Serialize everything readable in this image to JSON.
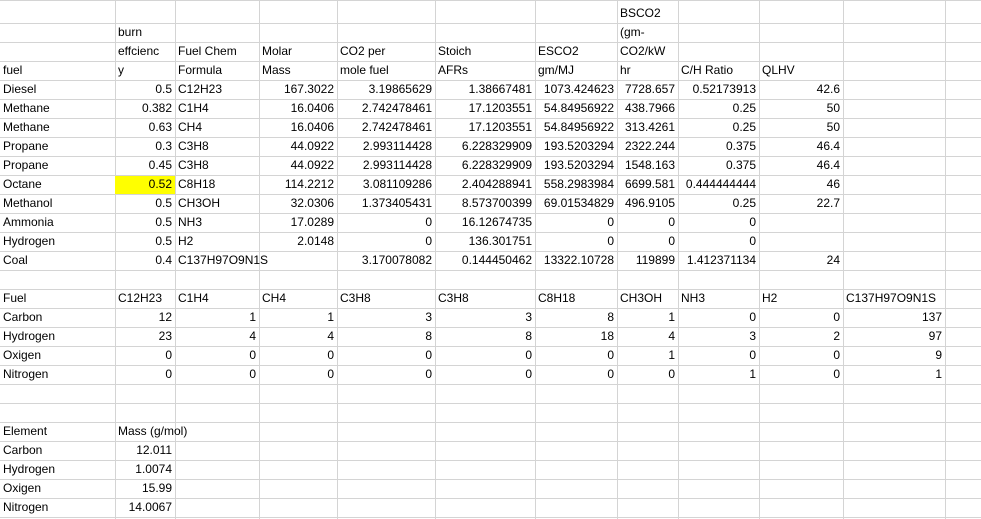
{
  "sheet": {
    "header": {
      "fuel": "fuel",
      "burn_line1": "burn",
      "burn_line2": "effcienc",
      "burn_line3": "y",
      "chem_line1": "Fuel Chem",
      "chem_line2": "Formula",
      "molar_line1": "Molar",
      "molar_line2": "Mass",
      "co2_line1": "CO2 per",
      "co2_line2": "mole fuel",
      "stoich_line1": "Stoich",
      "stoich_line2": "AFRs",
      "esco2_line1": "ESCO2",
      "esco2_line2": "gm/MJ",
      "bsco2_line1": "BSCO2",
      "bsco2_line2": "(gm-",
      "bsco2_line3": "CO2/kW",
      "bsco2_line4": "hr",
      "ch_ratio": "C/H Ratio",
      "qlhv": "QLHV"
    },
    "fuels": [
      {
        "fuel": "Diesel",
        "burn": "0.5",
        "formula": "C12H23",
        "molar": "167.3022",
        "co2": "3.19865629",
        "stoich": "1.38667481",
        "esco2": "1073.424623",
        "bsco2": "7728.657",
        "ch": "0.52173913",
        "qlhv": "42.6"
      },
      {
        "fuel": "Methane",
        "burn": "0.382",
        "formula": "C1H4",
        "molar": "16.0406",
        "co2": "2.742478461",
        "stoich": "17.1203551",
        "esco2": "54.84956922",
        "bsco2": "438.7966",
        "ch": "0.25",
        "qlhv": "50"
      },
      {
        "fuel": "Methane",
        "burn": "0.63",
        "formula": "CH4",
        "molar": "16.0406",
        "co2": "2.742478461",
        "stoich": "17.1203551",
        "esco2": "54.84956922",
        "bsco2": "313.4261",
        "ch": "0.25",
        "qlhv": "50"
      },
      {
        "fuel": "Propane",
        "burn": "0.3",
        "formula": "C3H8",
        "molar": "44.0922",
        "co2": "2.993114428",
        "stoich": "6.228329909",
        "esco2": "193.5203294",
        "bsco2": "2322.244",
        "ch": "0.375",
        "qlhv": "46.4"
      },
      {
        "fuel": "Propane",
        "burn": "0.45",
        "formula": "C3H8",
        "molar": "44.0922",
        "co2": "2.993114428",
        "stoich": "6.228329909",
        "esco2": "193.5203294",
        "bsco2": "1548.163",
        "ch": "0.375",
        "qlhv": "46.4"
      },
      {
        "fuel": "Octane",
        "burn": "0.52",
        "formula": "C8H18",
        "molar": "114.2212",
        "co2": "3.081109286",
        "stoich": "2.404288941",
        "esco2": "558.2983984",
        "bsco2": "6699.581",
        "ch": "0.444444444",
        "qlhv": "46"
      },
      {
        "fuel": "Methanol",
        "burn": "0.5",
        "formula": "CH3OH",
        "molar": "32.0306",
        "co2": "1.373405431",
        "stoich": "8.573700399",
        "esco2": "69.01534829",
        "bsco2": "496.9105",
        "ch": "0.25",
        "qlhv": "22.7"
      },
      {
        "fuel": "Ammonia",
        "burn": "0.5",
        "formula": "NH3",
        "molar": "17.0289",
        "co2": "0",
        "stoich": "16.12674735",
        "esco2": "0",
        "bsco2": "0",
        "ch": "0",
        "qlhv": ""
      },
      {
        "fuel": "Hydrogen",
        "burn": "0.5",
        "formula": "H2",
        "molar": "2.0148",
        "co2": "0",
        "stoich": "136.301751",
        "esco2": "0",
        "bsco2": "0",
        "ch": "0",
        "qlhv": ""
      },
      {
        "fuel": "Coal",
        "burn": "0.4",
        "formula": "C137H97O9N1S",
        "molar": "",
        "co2": "3.170078082",
        "stoich": "0.144450462",
        "esco2": "13322.10728",
        "bsco2": "119899",
        "ch": "1.412371134",
        "qlhv": "24"
      }
    ],
    "highlight_color": "#ffff00",
    "composition": {
      "header_label": "Fuel",
      "columns": [
        "C12H23",
        "C1H4",
        "CH4",
        "C3H8",
        "C3H8",
        "C8H18",
        "CH3OH",
        "NH3",
        "H2",
        "C137H97O9N1S"
      ],
      "rows": [
        {
          "label": "Carbon",
          "values": [
            "12",
            "1",
            "1",
            "3",
            "3",
            "8",
            "1",
            "0",
            "0",
            "137"
          ]
        },
        {
          "label": "Hydrogen",
          "values": [
            "23",
            "4",
            "4",
            "8",
            "8",
            "18",
            "4",
            "3",
            "2",
            "97"
          ]
        },
        {
          "label": "Oxigen",
          "values": [
            "0",
            "0",
            "0",
            "0",
            "0",
            "0",
            "1",
            "0",
            "0",
            "9"
          ]
        },
        {
          "label": "Nitrogen",
          "values": [
            "0",
            "0",
            "0",
            "0",
            "0",
            "0",
            "0",
            "1",
            "0",
            "1"
          ]
        }
      ]
    },
    "elements": {
      "header_label": "Element",
      "header_mass": "Mass (g/mol)",
      "rows": [
        {
          "label": "Carbon",
          "mass": "12.011"
        },
        {
          "label": "Hydrogen",
          "mass": "1.0074"
        },
        {
          "label": "Oxigen",
          "mass": "15.99"
        },
        {
          "label": "Nitrogen",
          "mass": "14.0067"
        }
      ]
    }
  }
}
